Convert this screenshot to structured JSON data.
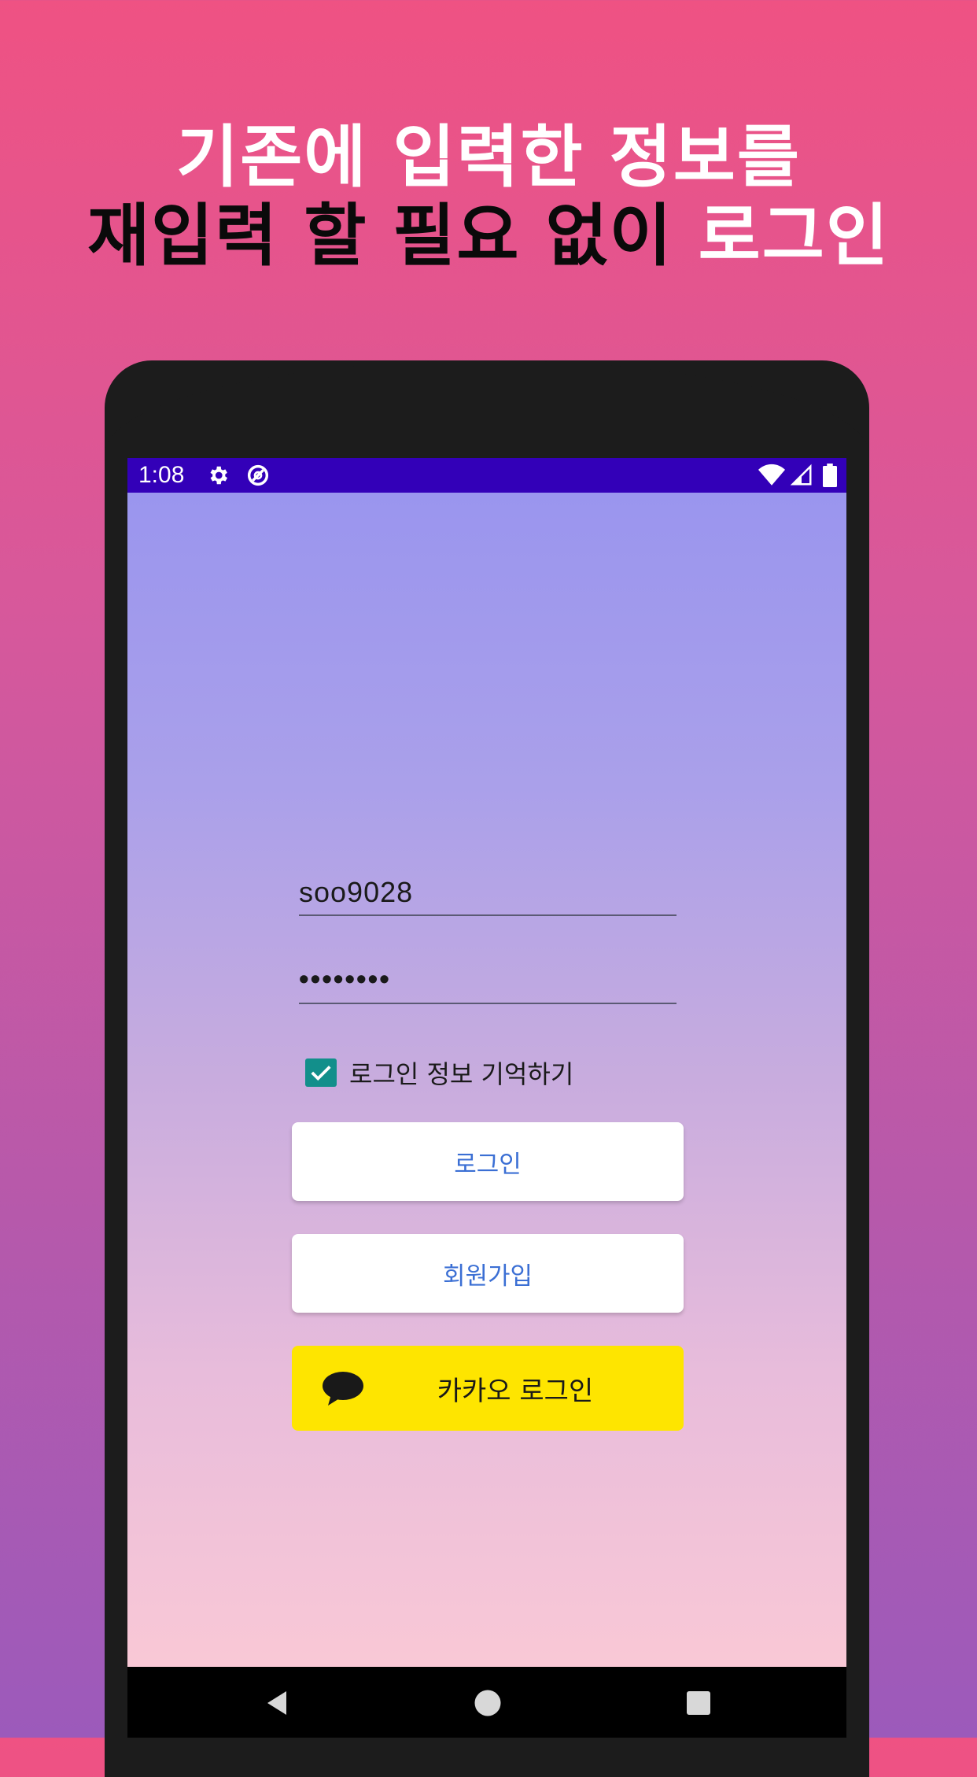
{
  "headline": {
    "line1": "기존에 입력한 정보를",
    "line2_black": "재입력 할 필요 없이 ",
    "line2_white": "로그인"
  },
  "statusbar": {
    "time": "1:08",
    "icons": [
      "gear-icon",
      "data-saver-icon",
      "wifi-icon",
      "cell-signal-icon",
      "battery-icon"
    ]
  },
  "login_form": {
    "id_value": "soo9028",
    "password_value": "••••••••",
    "remember_label": "로그인 정보 기억하기",
    "remember_checked": true,
    "login_button": "로그인",
    "signup_button": "회원가입",
    "kakao_button": "카카오 로그인"
  },
  "navbar": {
    "icons": [
      "back-icon",
      "home-icon",
      "recents-icon"
    ]
  },
  "colors": {
    "statusbar": "#3300b8",
    "checkbox": "#128f8b",
    "button_text": "#3b6fd4",
    "kakao": "#fee500"
  }
}
